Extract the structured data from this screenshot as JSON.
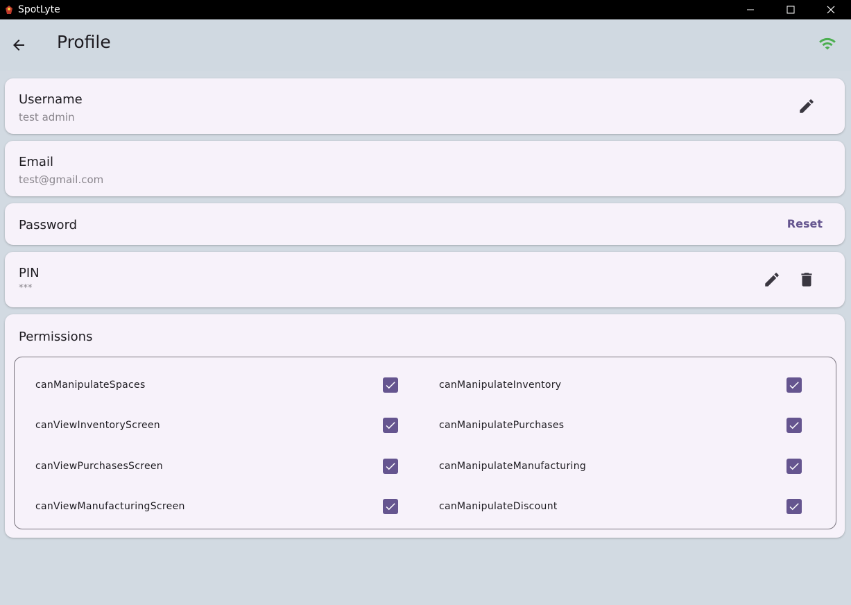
{
  "window": {
    "title": "SpotLyte",
    "controls": [
      "minimize-icon",
      "maximize-icon",
      "close-icon"
    ]
  },
  "appbar": {
    "title": "Profile",
    "back_icon": "arrow-left-icon",
    "status_icon": "wifi-icon",
    "status_color": "#4caf50"
  },
  "username": {
    "label": "Username",
    "value": "test admin",
    "action_icon": "pencil-icon"
  },
  "email": {
    "label": "Email",
    "value": "test@gmail.com"
  },
  "password": {
    "label": "Password",
    "action_label": "Reset"
  },
  "pin": {
    "label": "PIN",
    "value": "***",
    "action_icons": [
      "pencil-icon",
      "trash-icon"
    ]
  },
  "permissions": {
    "label": "Permissions",
    "items": [
      {
        "name": "canManipulateSpaces",
        "checked": true
      },
      {
        "name": "canManipulateInventory",
        "checked": true
      },
      {
        "name": "canViewInventoryScreen",
        "checked": true
      },
      {
        "name": "canManipulatePurchases",
        "checked": true
      },
      {
        "name": "canViewPurchasesScreen",
        "checked": true
      },
      {
        "name": "canManipulateManufacturing",
        "checked": true
      },
      {
        "name": "canViewManufacturingScreen",
        "checked": true
      },
      {
        "name": "canManipulateDiscount",
        "checked": true
      }
    ]
  },
  "colors": {
    "accent": "#65558f",
    "card_bg": "#f7f2fa",
    "page_bg": "#d2dae2"
  }
}
